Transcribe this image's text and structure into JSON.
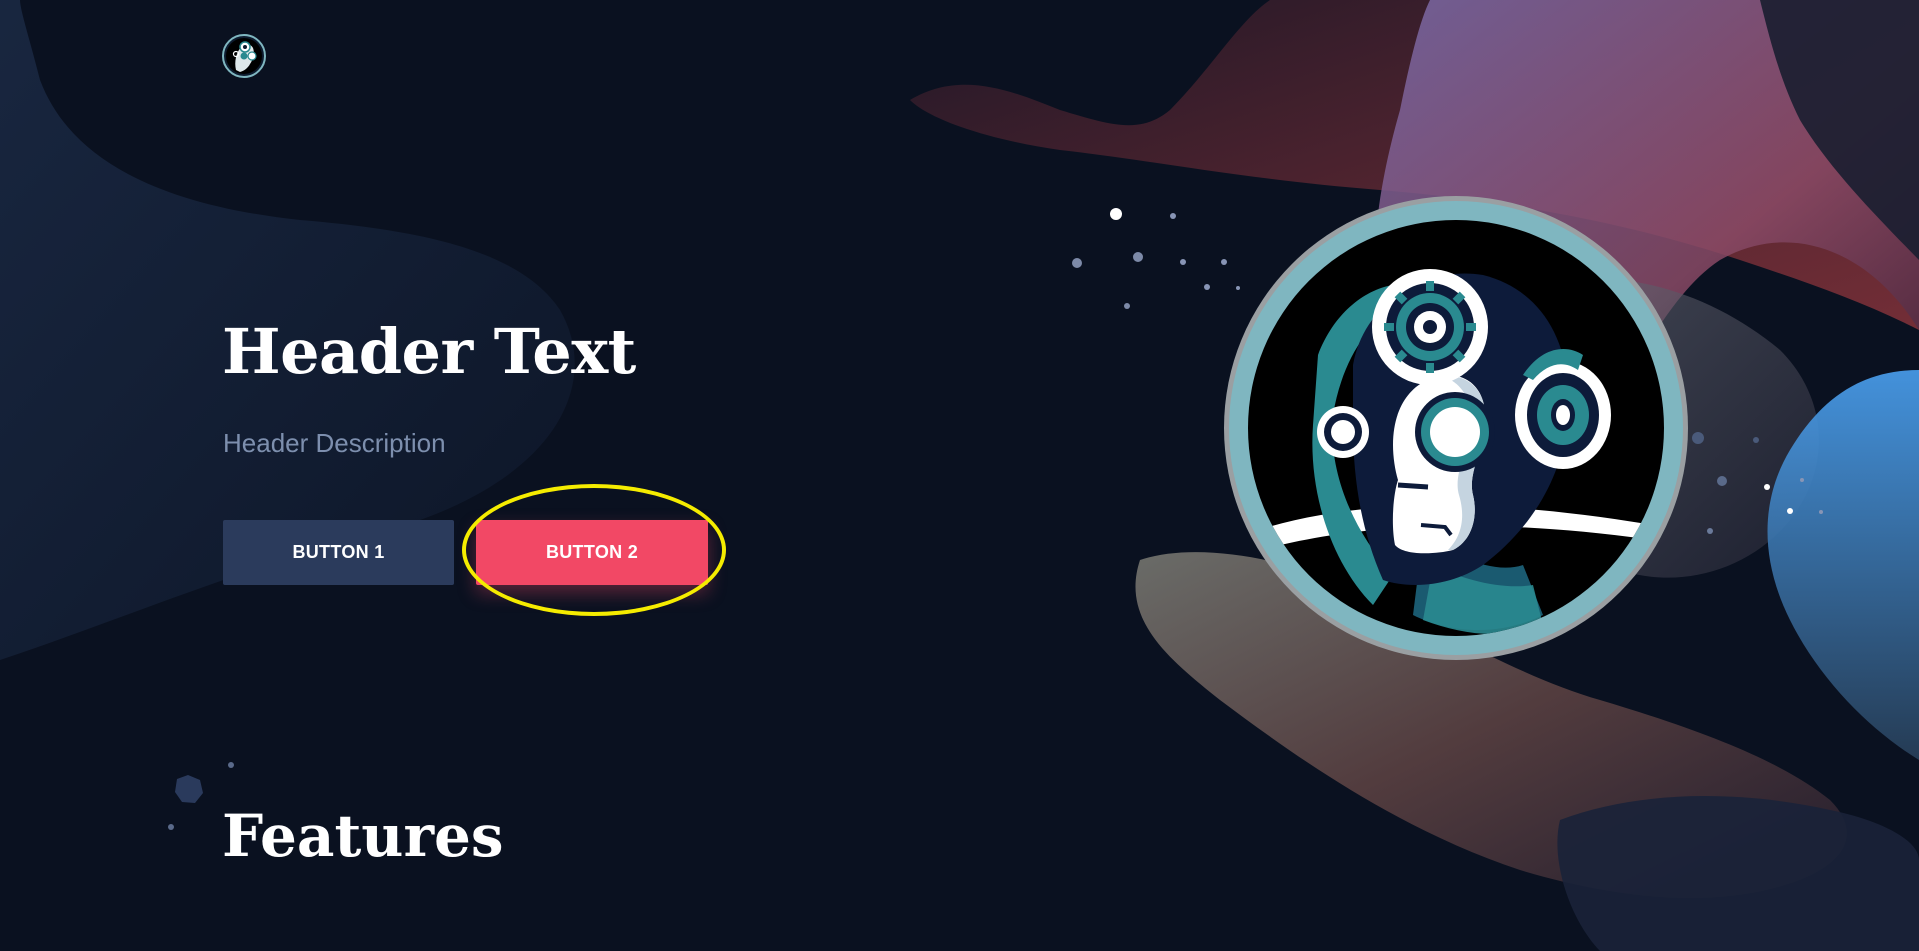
{
  "hero": {
    "title": "Header Text",
    "description": "Header Description",
    "button1_label": "BUTTON 1",
    "button2_label": "BUTTON 2"
  },
  "features": {
    "title": "Features"
  },
  "icons": {
    "logo": "robot-head-logo-icon",
    "hero_image": "robot-head-gears-illustration"
  },
  "colors": {
    "background": "#0a1120",
    "button1": "#2b3b5c",
    "button2": "#f24865",
    "highlight": "#f5ec00",
    "description": "#7d8fae"
  }
}
